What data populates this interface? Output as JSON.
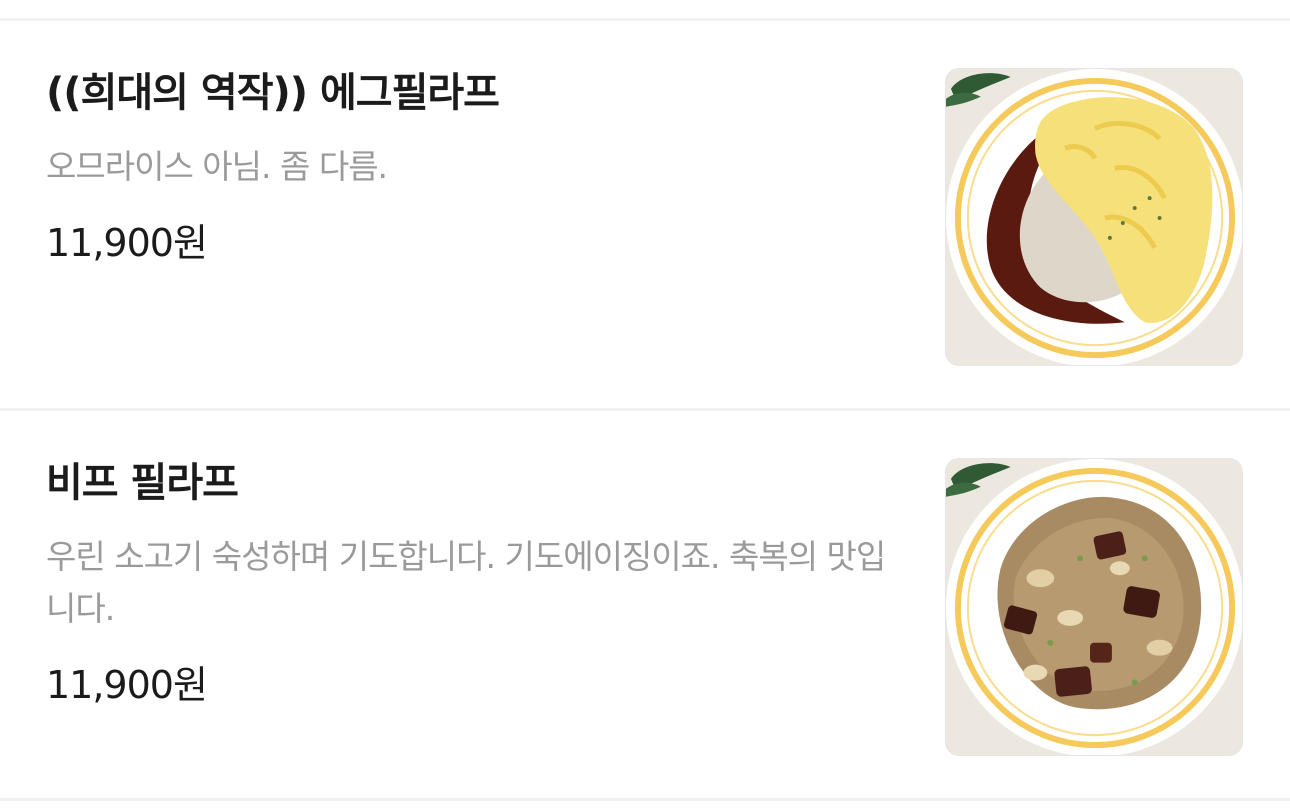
{
  "menu": {
    "items": [
      {
        "name": "((희대의 역작)) 에그필라프",
        "description": "오므라이스 아님. 좀 다름.",
        "price": "11,900원",
        "image": "egg-pilaf-photo"
      },
      {
        "name": "비프 필라프",
        "description": "우린 소고기 숙성하며 기도합니다. 기도에이징이죠. 축복의 맛입니다.",
        "price": "11,900원",
        "image": "beef-pilaf-photo"
      }
    ]
  },
  "colors": {
    "name": "#1b1b1b",
    "description": "#9a9a9a",
    "price": "#1b1b1b",
    "divider": "#f1f1f1",
    "plate_rim": "#f5c95a"
  }
}
